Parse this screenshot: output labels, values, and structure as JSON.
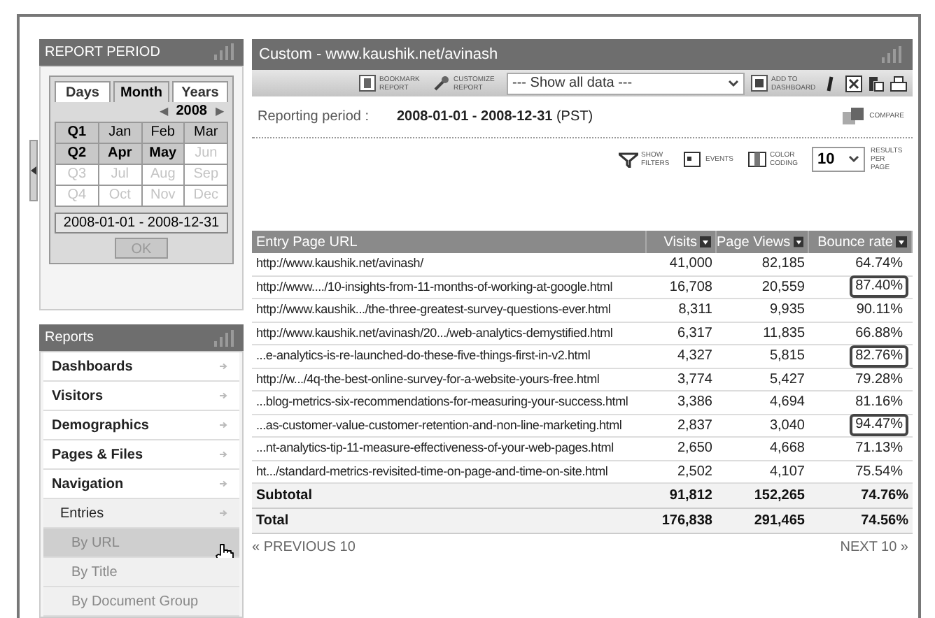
{
  "report_period": {
    "title": "REPORT PERIOD",
    "tabs": [
      {
        "label": "Days",
        "selected": false
      },
      {
        "label": "Month",
        "selected": true
      },
      {
        "label": "Years",
        "selected": false
      }
    ],
    "year": "2008",
    "prev_arrow": "◀",
    "next_arrow": "▶",
    "grid": [
      {
        "quarter": "Q1",
        "enabled": true,
        "months": [
          {
            "label": "Jan",
            "enabled": true
          },
          {
            "label": "Feb",
            "enabled": true
          },
          {
            "label": "Mar",
            "enabled": true
          }
        ]
      },
      {
        "quarter": "Q2",
        "enabled": true,
        "months": [
          {
            "label": "Apr",
            "enabled": true
          },
          {
            "label": "May",
            "enabled": true
          },
          {
            "label": "Jun",
            "enabled": false
          }
        ]
      },
      {
        "quarter": "Q3",
        "enabled": false,
        "months": [
          {
            "label": "Jul",
            "enabled": false
          },
          {
            "label": "Aug",
            "enabled": false
          },
          {
            "label": "Sep",
            "enabled": false
          }
        ]
      },
      {
        "quarter": "Q4",
        "enabled": false,
        "months": [
          {
            "label": "Oct",
            "enabled": false
          },
          {
            "label": "Nov",
            "enabled": false
          },
          {
            "label": "Dec",
            "enabled": false
          }
        ]
      }
    ],
    "range": "2008-01-01 - 2008-12-31",
    "ok_button": {
      "label": "OK",
      "disabled": true
    }
  },
  "reports": {
    "title": "Reports",
    "items": [
      {
        "kind": "section",
        "label": "Dashboards",
        "selected": false
      },
      {
        "kind": "section",
        "label": "Visitors",
        "selected": false
      },
      {
        "kind": "section",
        "label": "Demographics",
        "selected": false
      },
      {
        "kind": "section",
        "label": "Pages & Files",
        "selected": false
      },
      {
        "kind": "section",
        "label": "Navigation",
        "selected": false
      },
      {
        "kind": "sub",
        "label": "Entries",
        "selected": false
      },
      {
        "kind": "leaf",
        "label": "By URL",
        "selected": true
      },
      {
        "kind": "leaf",
        "label": "By Title",
        "selected": false
      },
      {
        "kind": "leaf",
        "label": "By Document Group",
        "selected": false
      }
    ]
  },
  "main": {
    "title": "Custom - www.kaushik.net/avinash",
    "toolbar": {
      "bookmark": "BOOKMARK REPORT",
      "customize": "CUSTOMIZE REPORT",
      "filter_select": "--- Show all data ---",
      "add_to_dashboard": "ADD TO DASHBOARD"
    },
    "reporting_period": {
      "label": "Reporting period :",
      "value": "2008-01-01 - 2008-12-31",
      "timezone": "(PST)"
    },
    "compare": "COMPARE",
    "options": {
      "show_filters": "SHOW FILTERS",
      "events": "EVENTS",
      "color_coding": "COLOR CODING",
      "results_count": "10",
      "results_label": "RESULTS PER PAGE"
    },
    "table": {
      "columns": [
        {
          "label": "Entry Page URL",
          "sortable": false
        },
        {
          "label": "Visits",
          "sortable": true
        },
        {
          "label": "Page Views",
          "sortable": true
        },
        {
          "label": "Bounce rate",
          "sortable": true
        }
      ],
      "rows": [
        {
          "url": "http://www.kaushik.net/avinash/",
          "visits": "41,000",
          "page_views": "82,185",
          "bounce_rate": "64.74%",
          "highlighted": false
        },
        {
          "url": "http://www..../10-insights-from-11-months-of-working-at-google.html",
          "visits": "16,708",
          "page_views": "20,559",
          "bounce_rate": "87.40%",
          "highlighted": true
        },
        {
          "url": "http://www.kaushik.../the-three-greatest-survey-questions-ever.html",
          "visits": "8,311",
          "page_views": "9,935",
          "bounce_rate": "90.11%",
          "highlighted": false
        },
        {
          "url": "http://www.kaushik.net/avinash/20.../web-analytics-demystified.html",
          "visits": "6,317",
          "page_views": "11,835",
          "bounce_rate": "66.88%",
          "highlighted": false
        },
        {
          "url": "...e-analytics-is-re-launched-do-these-five-things-first-in-v2.html",
          "visits": "4,327",
          "page_views": "5,815",
          "bounce_rate": "82.76%",
          "highlighted": true
        },
        {
          "url": "http://w.../4q-the-best-online-survey-for-a-website-yours-free.html",
          "visits": "3,774",
          "page_views": "5,427",
          "bounce_rate": "79.28%",
          "highlighted": false
        },
        {
          "url": "...blog-metrics-six-recommendations-for-measuring-your-success.html",
          "visits": "3,386",
          "page_views": "4,694",
          "bounce_rate": "81.16%",
          "highlighted": false
        },
        {
          "url": "...as-customer-value-customer-retention-and-non-line-marketing.html",
          "visits": "2,837",
          "page_views": "3,040",
          "bounce_rate": "94.47%",
          "highlighted": true
        },
        {
          "url": "...nt-analytics-tip-11-measure-effectiveness-of-your-web-pages.html",
          "visits": "2,650",
          "page_views": "4,668",
          "bounce_rate": "71.13%",
          "highlighted": false
        },
        {
          "url": "ht.../standard-metrics-revisited-time-on-page-and-time-on-site.html",
          "visits": "2,502",
          "page_views": "4,107",
          "bounce_rate": "75.54%",
          "highlighted": false
        }
      ],
      "totals": [
        {
          "label": "Subtotal",
          "visits": "91,812",
          "page_views": "152,265",
          "bounce_rate": "74.76%"
        },
        {
          "label": "Total",
          "visits": "176,838",
          "page_views": "291,465",
          "bounce_rate": "74.56%"
        }
      ]
    },
    "pagination": {
      "previous": "« PREVIOUS 10",
      "next": "NEXT 10 »"
    }
  }
}
